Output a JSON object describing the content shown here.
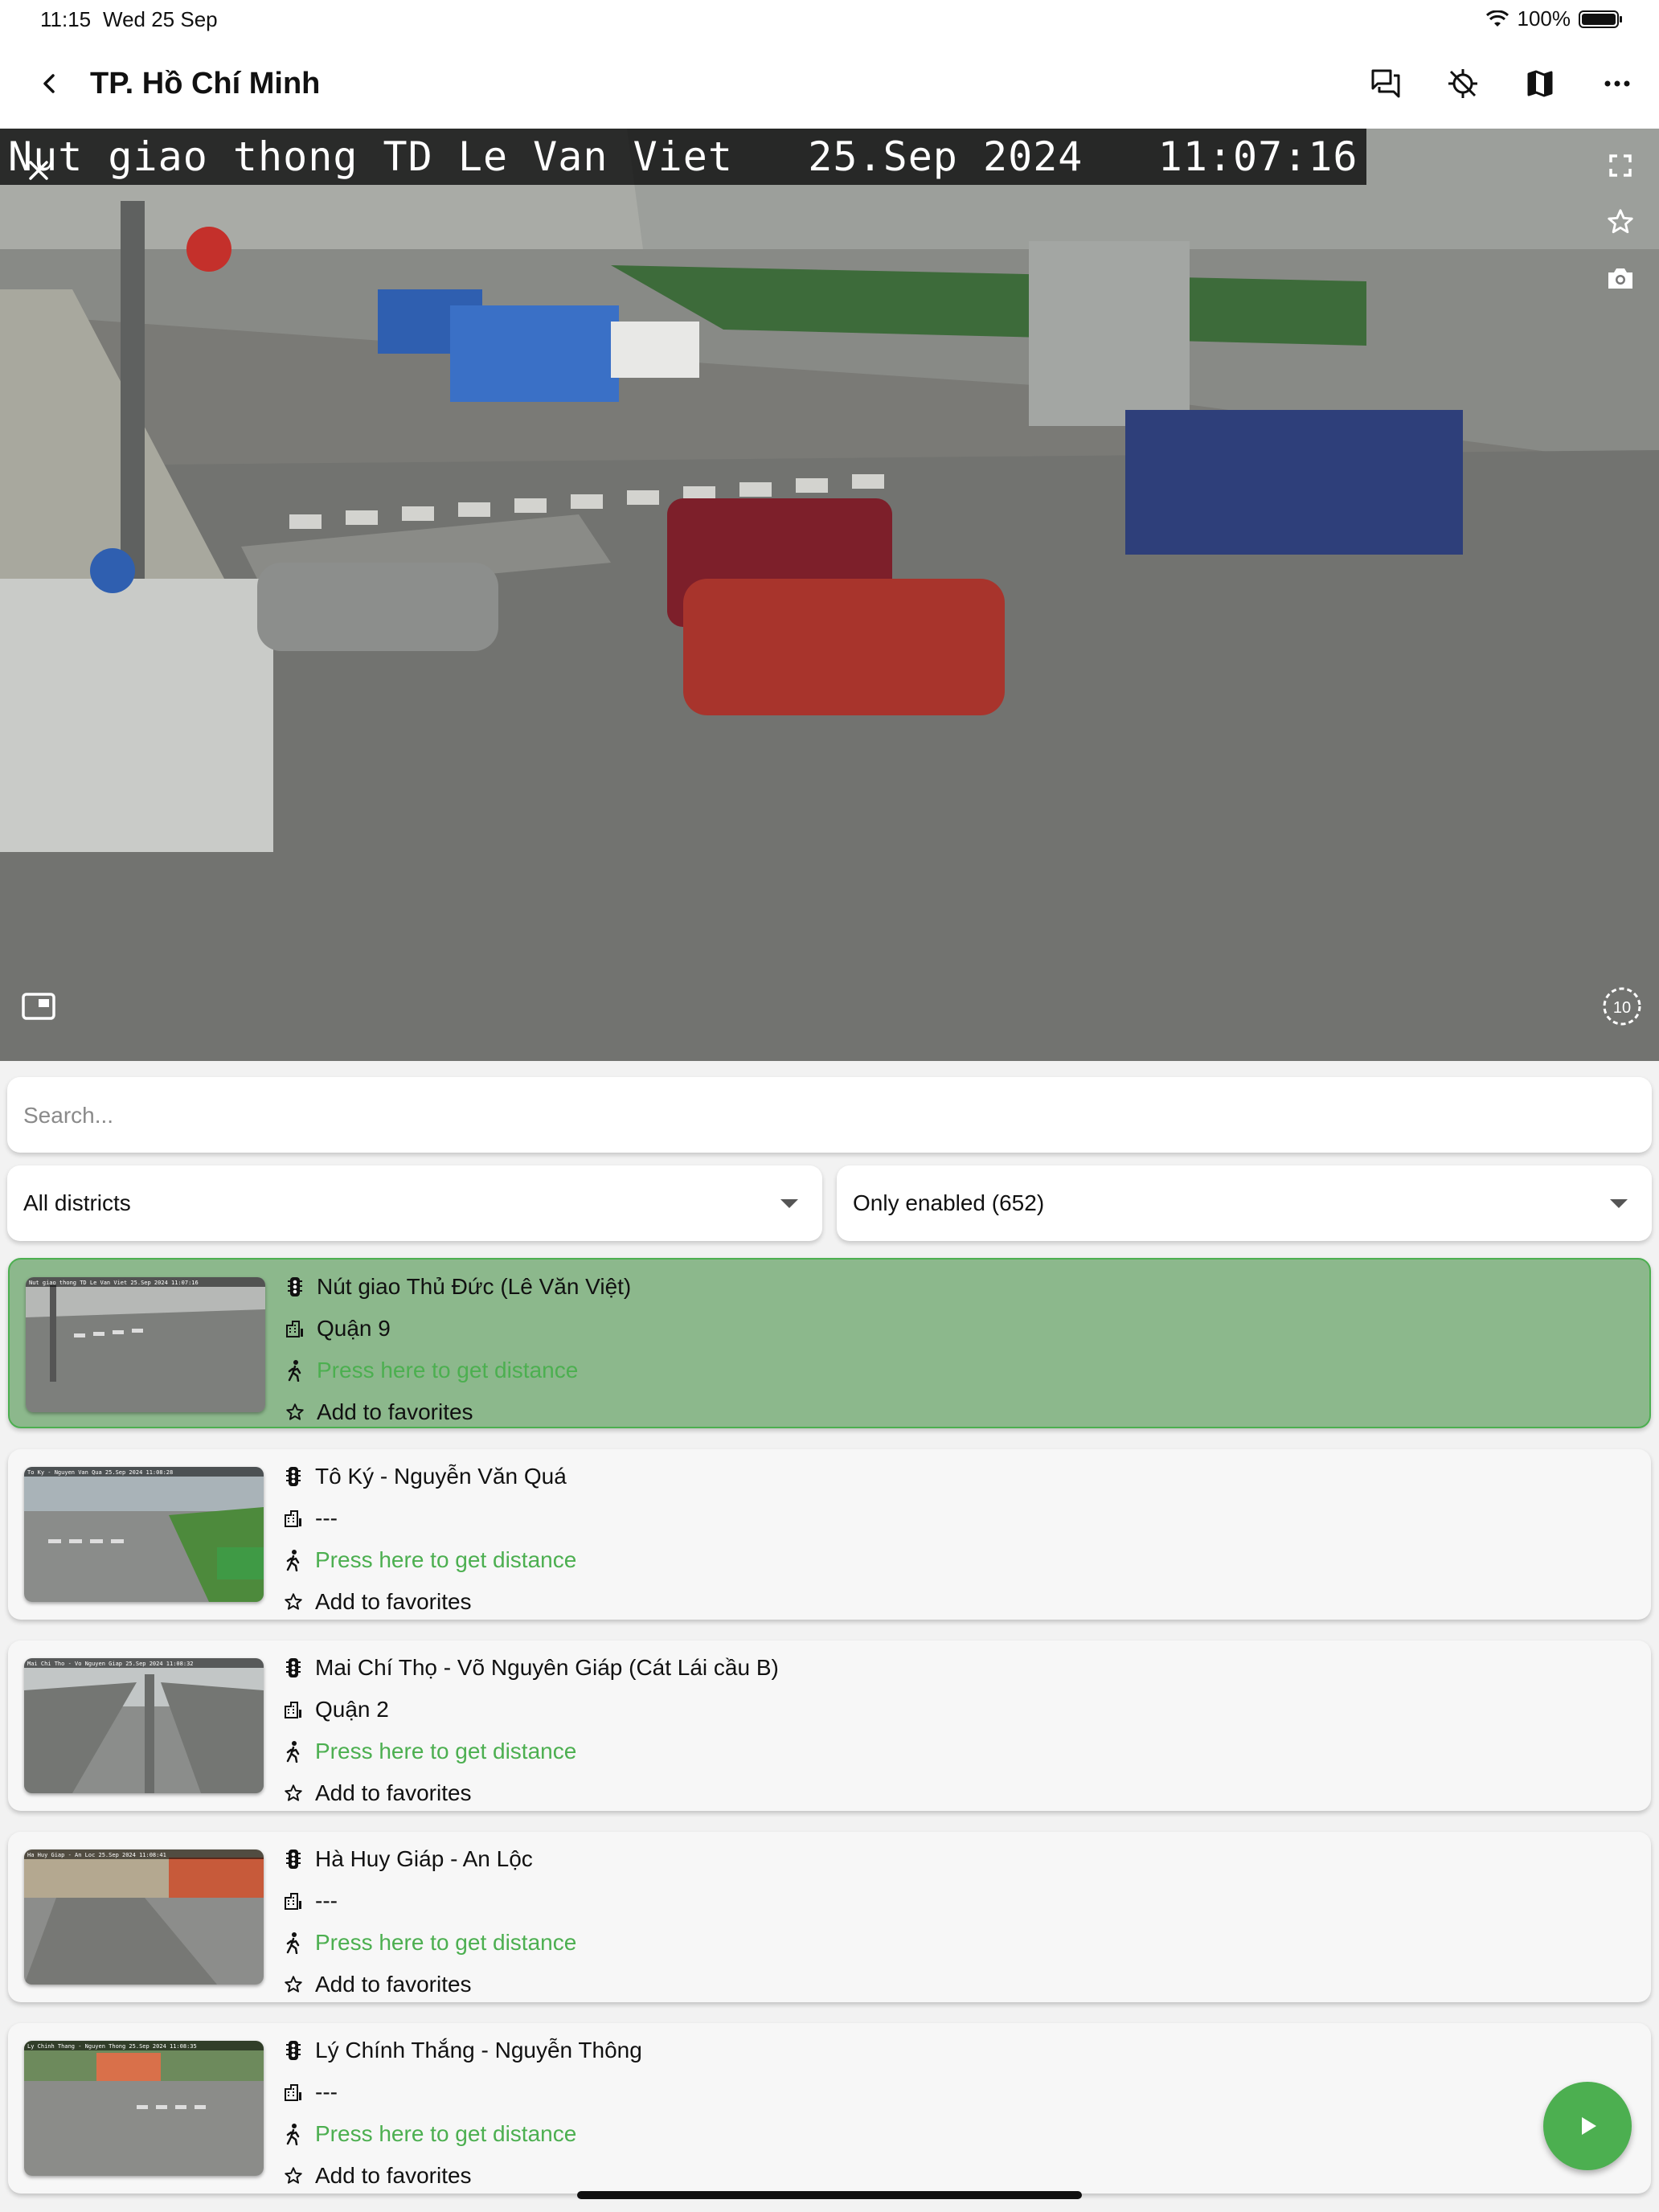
{
  "status": {
    "time": "11:15",
    "date": "Wed 25 Sep",
    "battery": "100%"
  },
  "appbar": {
    "title": "TP. Hồ Chí Minh",
    "icons": [
      "back-arrow-icon",
      "chat-icon",
      "location-off-icon",
      "map-icon",
      "more-horiz-icon"
    ]
  },
  "video": {
    "overlay_text": "Nut giao thong TD Le Van Viet   25.Sep 2024   11:07:16",
    "refresh_seconds": "10",
    "icons": [
      "close-icon",
      "fullscreen-icon",
      "star-outline-icon",
      "camera-icon",
      "picture-in-picture-icon",
      "refresh-timer-icon"
    ]
  },
  "search": {
    "placeholder": "Search...",
    "value": ""
  },
  "filters": {
    "district": "All districts",
    "status": "Only enabled (652)"
  },
  "colors": {
    "accent": "#4caf50",
    "selected_bg": "#8cb88c"
  },
  "cameras": [
    {
      "name": "Nút giao Thủ Đức (Lê Văn Việt)",
      "district": "Quận 9",
      "distance": "Press here to get distance",
      "favorite": "Add to favorites",
      "selected": true,
      "thumb_overlay": "Nut giao thong TD Le Van Viet  25.Sep 2024  11:07:16"
    },
    {
      "name": "Tô Ký - Nguyễn Văn Quá",
      "district": "---",
      "distance": "Press here to get distance",
      "favorite": "Add to favorites",
      "selected": false,
      "thumb_overlay": "To Ky - Nguyen Van Qua   25.Sep 2024  11:08:28"
    },
    {
      "name": "Mai Chí Thọ - Võ Nguyên Giáp (Cát Lái cầu B)",
      "district": "Quận 2",
      "distance": "Press here to get distance",
      "favorite": "Add to favorites",
      "selected": false,
      "thumb_overlay": "Mai Chi Tho - Vo Nguyen Giap   25.Sep 2024  11:08:32"
    },
    {
      "name": "Hà Huy Giáp - An Lộc",
      "district": "---",
      "distance": "Press here to get distance",
      "favorite": "Add to favorites",
      "selected": false,
      "thumb_overlay": "Ha Huy Giap - An Loc   25.Sep 2024  11:08:41"
    },
    {
      "name": "Lý Chính Thắng - Nguyễn Thông",
      "district": "---",
      "distance": "Press here to get distance",
      "favorite": "Add to favorites",
      "selected": false,
      "thumb_overlay": "Ly Chinh Thang - Nguyen Thong   25.Sep 2024  11:08:35"
    }
  ],
  "fab": {
    "icon": "play-icon"
  }
}
